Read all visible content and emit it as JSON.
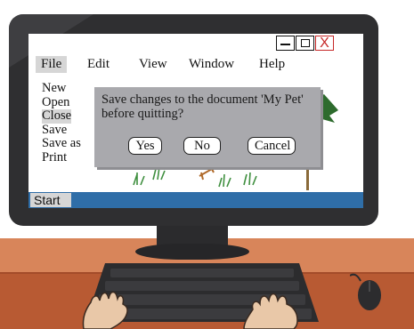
{
  "window": {
    "controls": [
      "minimize-icon",
      "maximize-icon",
      "close-icon"
    ],
    "close_label": "X"
  },
  "menubar": {
    "file": "File",
    "edit": "Edit",
    "view": "View",
    "window": "Window",
    "help": "Help"
  },
  "file_menu": {
    "items": [
      "New",
      "Open",
      "Close",
      "Save",
      "Save as",
      "Print"
    ],
    "highlighted": "Close"
  },
  "dialog": {
    "message": "Save changes to the document 'My Pet' before quitting?",
    "yes": "Yes",
    "no": "No",
    "cancel": "Cancel"
  },
  "taskbar": {
    "start": "Start"
  },
  "colors": {
    "taskbar": "#2f6ea8",
    "dialog": "#a9a9ad",
    "close_accent": "#c62828",
    "monitor_frame": "#2f2f31",
    "desk": "#d8855a"
  }
}
